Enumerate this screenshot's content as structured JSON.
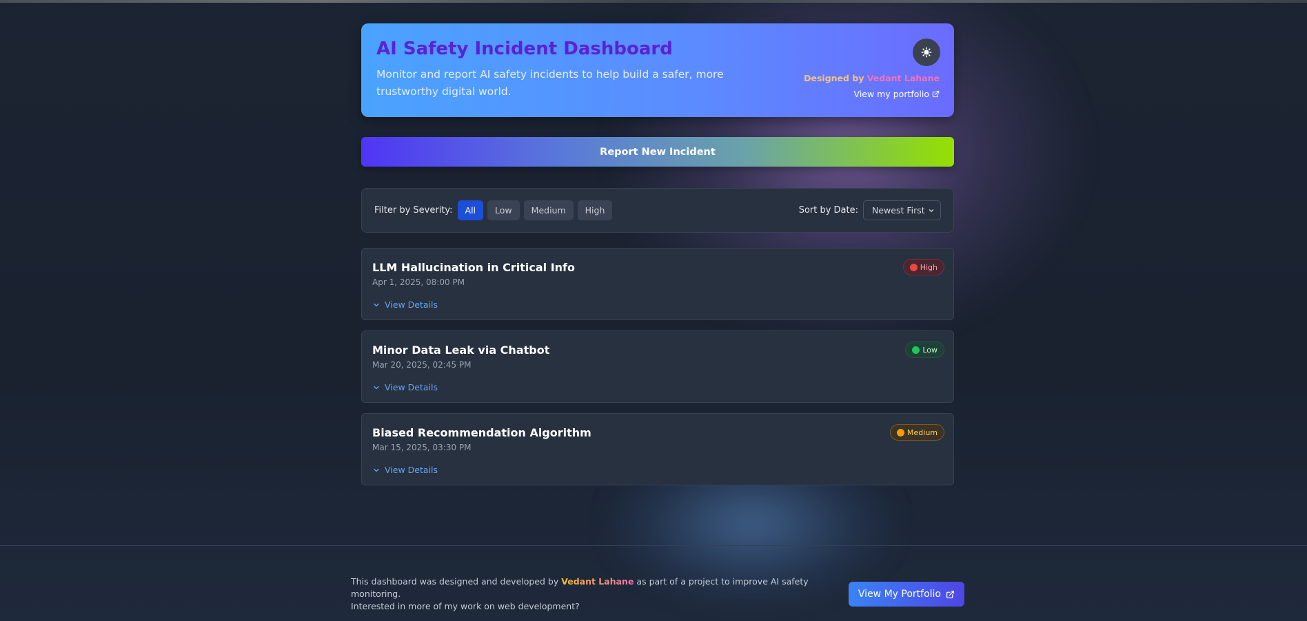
{
  "header": {
    "title": "AI Safety Incident Dashboard",
    "subtitle": "Monitor and report AI safety incidents to help build a safer, more trustworthy digital world.",
    "theme_toggle_icon": "sun-icon",
    "designed_by_prefix": "Designed by",
    "designer_name": "Vedant Lahane",
    "portfolio_link": "View my portfolio"
  },
  "report_button": "Report New Incident",
  "filter": {
    "label": "Filter by Severity:",
    "options": [
      "All",
      "Low",
      "Medium",
      "High"
    ],
    "active": "All"
  },
  "sort": {
    "label": "Sort by Date:",
    "selected": "Newest First"
  },
  "incidents": [
    {
      "title": "LLM Hallucination in Critical Info",
      "date": "Apr 1, 2025, 08:00 PM",
      "severity": "High",
      "details_label": "View Details"
    },
    {
      "title": "Minor Data Leak via Chatbot",
      "date": "Mar 20, 2025, 02:45 PM",
      "severity": "Low",
      "details_label": "View Details"
    },
    {
      "title": "Biased Recommendation Algorithm",
      "date": "Mar 15, 2025, 03:30 PM",
      "severity": "Medium",
      "details_label": "View Details"
    }
  ],
  "footer": {
    "text_before": "This dashboard was designed and developed by",
    "name": "Vedant Lahane",
    "text_after": "as part of a project to improve AI safety monitoring.",
    "line2": "Interested in more of my work on web development?",
    "button": "View My Portfolio"
  },
  "colors": {
    "severity_high": "#ef4444",
    "severity_low": "#22c55e",
    "severity_medium": "#f59e0b",
    "accent": "#1d4ed8"
  }
}
